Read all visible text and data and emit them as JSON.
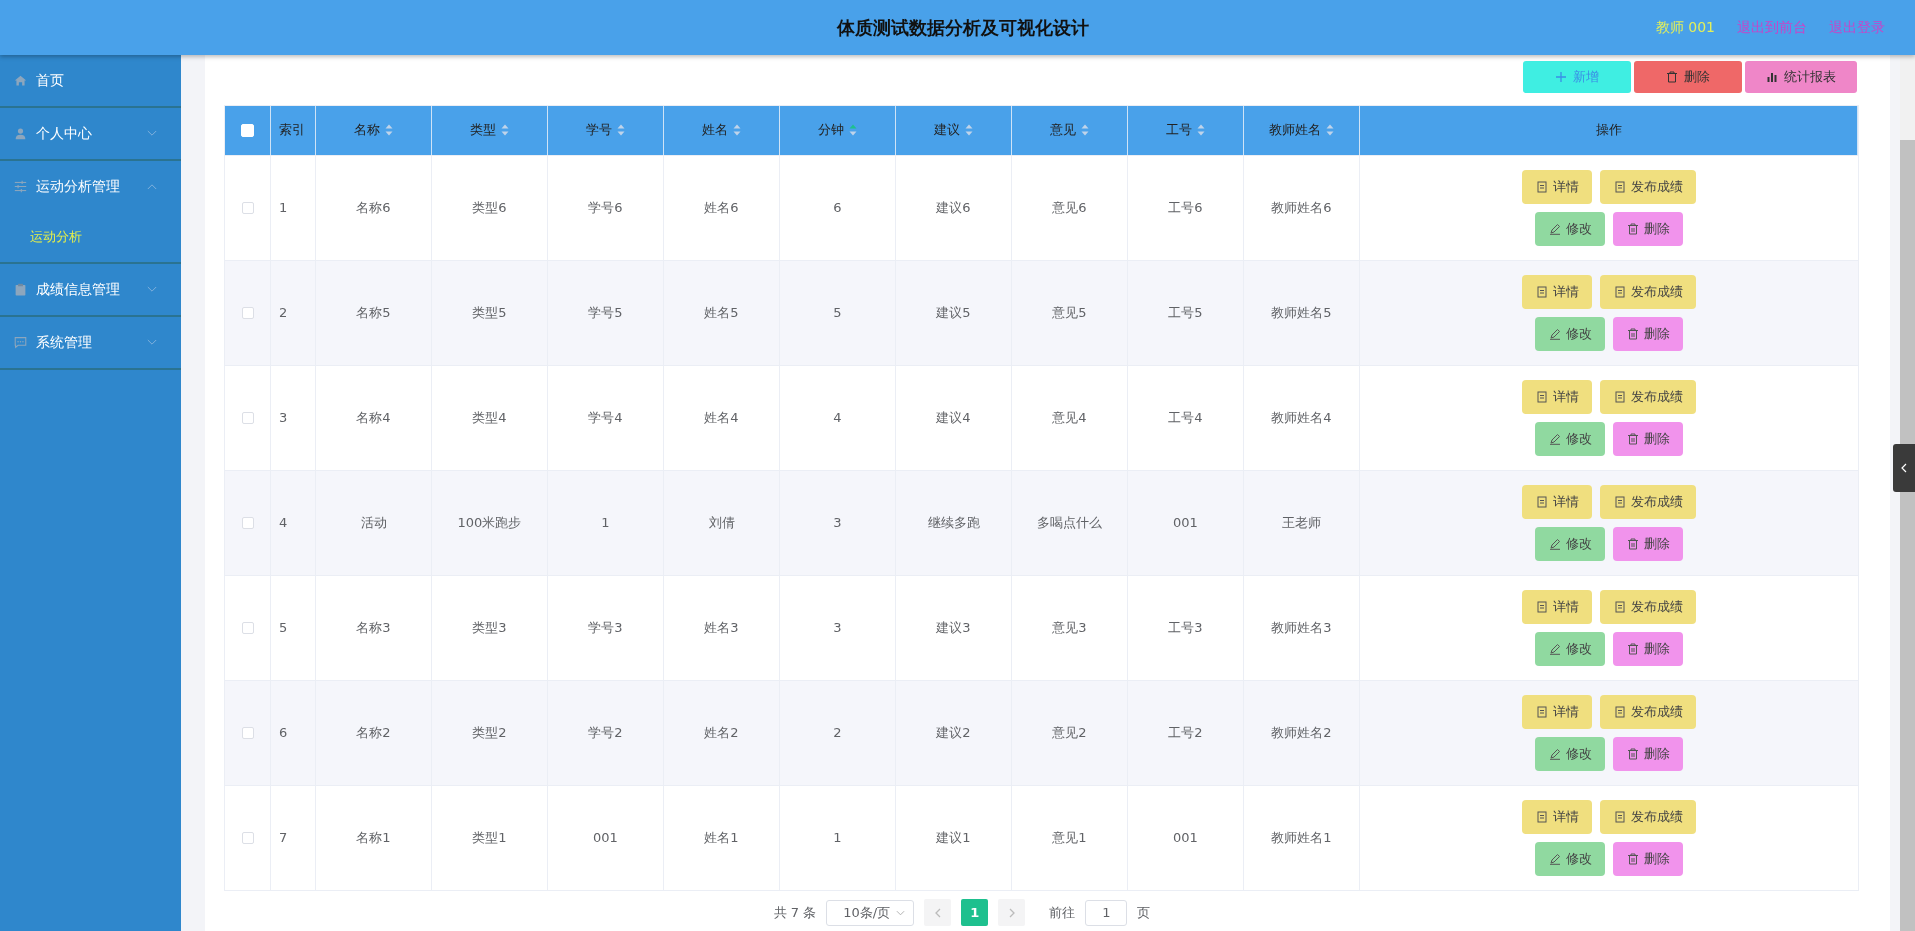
{
  "header": {
    "title": "体质测试数据分析及可视化设计",
    "user": "教师 001",
    "links": [
      "退出到前台",
      "退出登录"
    ]
  },
  "sidebar": {
    "items": [
      {
        "label": "首页",
        "kind": "home",
        "has_children": false
      },
      {
        "label": "个人中心",
        "kind": "user",
        "has_children": true,
        "expanded": false
      },
      {
        "label": "运动分析管理",
        "kind": "sliders",
        "has_children": true,
        "expanded": true,
        "children": [
          {
            "label": "运动分析",
            "selected": true
          }
        ]
      },
      {
        "label": "成绩信息管理",
        "kind": "clipboard",
        "has_children": true,
        "expanded": false
      },
      {
        "label": "系统管理",
        "kind": "chat",
        "has_children": true,
        "expanded": false
      }
    ]
  },
  "toolbar": [
    {
      "label": "新增",
      "kind": "add"
    },
    {
      "label": "删除",
      "kind": "delete"
    },
    {
      "label": "统计报表",
      "kind": "report"
    }
  ],
  "table": {
    "all_checked": false,
    "columns": [
      {
        "label": "索引",
        "sortable": false
      },
      {
        "label": "名称",
        "sortable": true,
        "sorted_ascending": false
      },
      {
        "label": "类型",
        "sortable": true,
        "sorted_ascending": false
      },
      {
        "label": "学号",
        "sortable": true,
        "sorted_ascending": false
      },
      {
        "label": "姓名",
        "sortable": true,
        "sorted_ascending": false
      },
      {
        "label": "分钟",
        "sortable": true,
        "sorted_ascending": true
      },
      {
        "label": "建议",
        "sortable": true,
        "sorted_ascending": false
      },
      {
        "label": "意见",
        "sortable": true,
        "sorted_ascending": false
      },
      {
        "label": "工号",
        "sortable": true,
        "sorted_ascending": false
      },
      {
        "label": "教师姓名",
        "sortable": true,
        "sorted_ascending": false
      },
      {
        "label": "操作",
        "sortable": false
      }
    ],
    "rows": [
      {
        "checked": false,
        "cells": [
          "1",
          "名称6",
          "类型6",
          "学号6",
          "姓名6",
          "6",
          "建议6",
          "意见6",
          "工号6",
          "教师姓名6"
        ],
        "actions": [
          {
            "label": "详情",
            "kind": "detail"
          },
          {
            "label": "发布成绩",
            "kind": "publish"
          },
          {
            "label": "修改",
            "kind": "edit"
          },
          {
            "label": "删除",
            "kind": "delete"
          }
        ]
      },
      {
        "checked": false,
        "cells": [
          "2",
          "名称5",
          "类型5",
          "学号5",
          "姓名5",
          "5",
          "建议5",
          "意见5",
          "工号5",
          "教师姓名5"
        ],
        "actions": [
          {
            "label": "详情",
            "kind": "detail"
          },
          {
            "label": "发布成绩",
            "kind": "publish"
          },
          {
            "label": "修改",
            "kind": "edit"
          },
          {
            "label": "删除",
            "kind": "delete"
          }
        ]
      },
      {
        "checked": false,
        "cells": [
          "3",
          "名称4",
          "类型4",
          "学号4",
          "姓名4",
          "4",
          "建议4",
          "意见4",
          "工号4",
          "教师姓名4"
        ],
        "actions": [
          {
            "label": "详情",
            "kind": "detail"
          },
          {
            "label": "发布成绩",
            "kind": "publish"
          },
          {
            "label": "修改",
            "kind": "edit"
          },
          {
            "label": "删除",
            "kind": "delete"
          }
        ]
      },
      {
        "checked": false,
        "cells": [
          "4",
          "活动",
          "100米跑步",
          "1",
          "刘倩",
          "3",
          "继续多跑",
          "多喝点什么",
          "001",
          "王老师"
        ],
        "actions": [
          {
            "label": "详情",
            "kind": "detail"
          },
          {
            "label": "发布成绩",
            "kind": "publish"
          },
          {
            "label": "修改",
            "kind": "edit"
          },
          {
            "label": "删除",
            "kind": "delete"
          }
        ]
      },
      {
        "checked": false,
        "cells": [
          "5",
          "名称3",
          "类型3",
          "学号3",
          "姓名3",
          "3",
          "建议3",
          "意见3",
          "工号3",
          "教师姓名3"
        ],
        "actions": [
          {
            "label": "详情",
            "kind": "detail"
          },
          {
            "label": "发布成绩",
            "kind": "publish"
          },
          {
            "label": "修改",
            "kind": "edit"
          },
          {
            "label": "删除",
            "kind": "delete"
          }
        ]
      },
      {
        "checked": false,
        "cells": [
          "6",
          "名称2",
          "类型2",
          "学号2",
          "姓名2",
          "2",
          "建议2",
          "意见2",
          "工号2",
          "教师姓名2"
        ],
        "actions": [
          {
            "label": "详情",
            "kind": "detail"
          },
          {
            "label": "发布成绩",
            "kind": "publish"
          },
          {
            "label": "修改",
            "kind": "edit"
          },
          {
            "label": "删除",
            "kind": "delete"
          }
        ]
      },
      {
        "checked": false,
        "cells": [
          "7",
          "名称1",
          "类型1",
          "001",
          "姓名1",
          "1",
          "建议1",
          "意见1",
          "001",
          "教师姓名1"
        ],
        "actions": [
          {
            "label": "详情",
            "kind": "detail"
          },
          {
            "label": "发布成绩",
            "kind": "publish"
          },
          {
            "label": "修改",
            "kind": "edit"
          },
          {
            "label": "删除",
            "kind": "delete"
          }
        ]
      }
    ]
  },
  "pagination": {
    "total": "共 7 条",
    "page_size": "10条/页",
    "pages": [
      {
        "label": "1",
        "selected": true
      }
    ],
    "goto_label": "前往",
    "goto_value": "1",
    "goto_suffix": "页"
  }
}
